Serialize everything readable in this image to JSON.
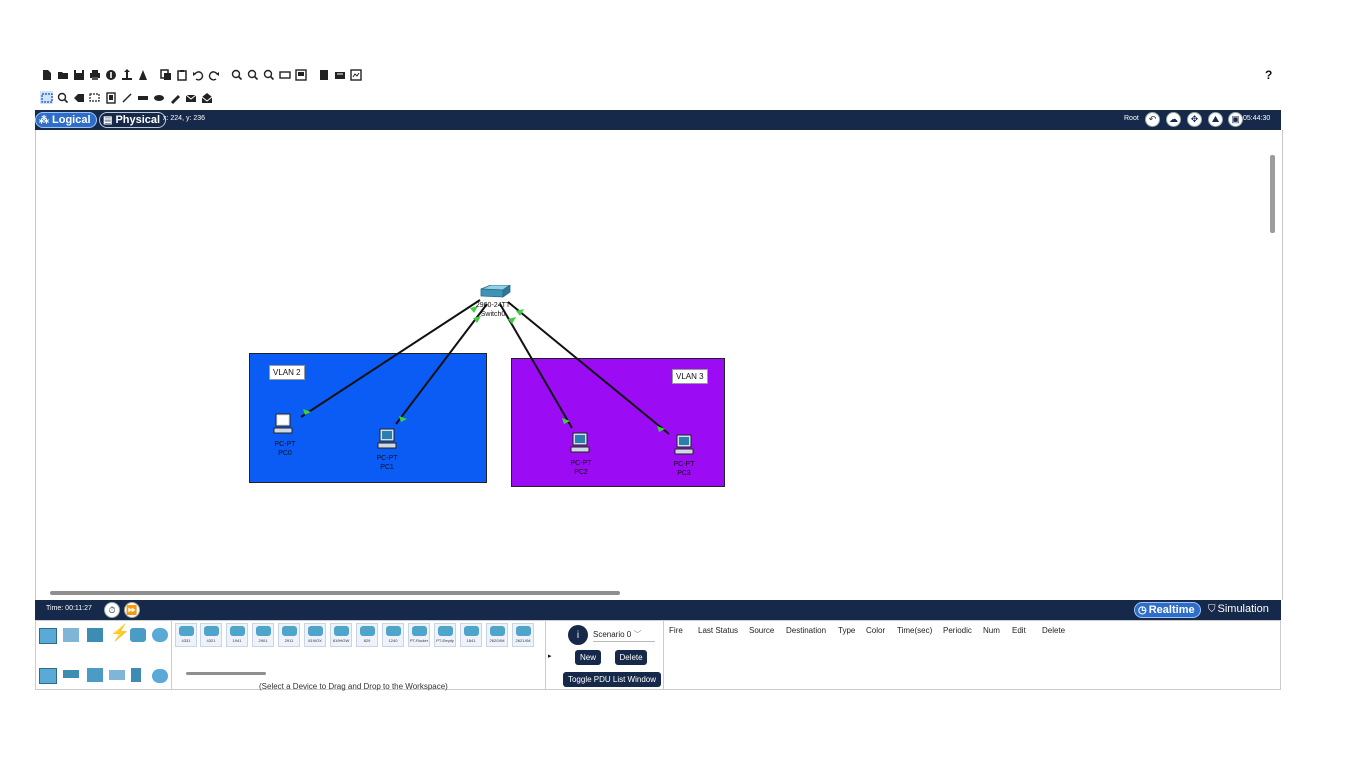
{
  "toolbar_top": {
    "icons": [
      "new-file",
      "open-folder",
      "save",
      "print",
      "activity-wizard",
      "custom-device",
      "pdu-wizard",
      "copy",
      "paste",
      "undo",
      "redo",
      "zoom-in",
      "zoom-reset",
      "zoom-out",
      "drawing-palette",
      "custom-devices-dialog",
      "view-1",
      "view-2",
      "view-3"
    ]
  },
  "toolbar_second": {
    "icons": [
      "select",
      "inspect",
      "delete",
      "resize",
      "note",
      "line",
      "rectangle",
      "ellipse",
      "freeform",
      "add-simple-pdu",
      "add-complex-pdu"
    ]
  },
  "help_label": "?",
  "workspace_tabs": {
    "logical": "Logical",
    "physical": "Physical",
    "coords": "x: 224, y: 236",
    "root": "Root",
    "clock": "05:44:30"
  },
  "topology": {
    "switch": {
      "model": "2960-24TT",
      "name": "Switch0"
    },
    "vlans": [
      {
        "label": "VLAN 2",
        "color": "#0a5cf5"
      },
      {
        "label": "VLAN 3",
        "color": "#9b0cf5"
      }
    ],
    "pcs": [
      {
        "type": "PC-PT",
        "name": "PC0"
      },
      {
        "type": "PC-PT",
        "name": "PC1"
      },
      {
        "type": "PC-PT",
        "name": "PC2"
      },
      {
        "type": "PC-PT",
        "name": "PC3"
      }
    ]
  },
  "bottom_bar": {
    "time": "Time: 00:11:27",
    "realtime": "Realtime",
    "simulation": "Simulation"
  },
  "device_panel": {
    "models": [
      "4331",
      "4321",
      "1941",
      "2901",
      "2911",
      "819IOX",
      "819HGW",
      "829",
      "1240",
      "PT-Router",
      "PT-Empty",
      "1841",
      "2620XM",
      "2621XM"
    ],
    "hint": "(Select a Device to Drag and Drop to the Workspace)"
  },
  "scenario": {
    "circle": "i",
    "select": "Scenario 0",
    "new": "New",
    "delete": "Delete",
    "toggle": "Toggle PDU List Window"
  },
  "pdu_headers": [
    "Fire",
    "Last Status",
    "Source",
    "Destination",
    "Type",
    "Color",
    "Time(sec)",
    "Periodic",
    "Num",
    "Edit",
    "Delete"
  ],
  "colors": {
    "dark_bar": "#17294a",
    "accent": "#2f6ec8"
  }
}
